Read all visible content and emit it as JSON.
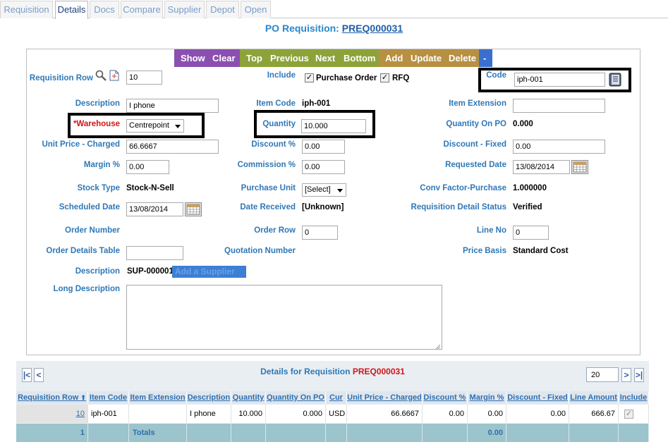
{
  "tabs": [
    {
      "label": "Requisition"
    },
    {
      "label": "Details"
    },
    {
      "label": "Docs"
    },
    {
      "label": "Compare"
    },
    {
      "label": "Supplier"
    },
    {
      "label": "Depot"
    },
    {
      "label": "Open"
    }
  ],
  "page": {
    "title_prefix": "PO Requisition:",
    "requisition_id": "PREQ000031"
  },
  "toolbar": {
    "show": "Show",
    "clear": "Clear",
    "top": "Top",
    "previous": "Previous",
    "next": "Next",
    "bottom": "Bottom",
    "add": "Add",
    "update": "Update",
    "delete": "Delete",
    "dash": "-"
  },
  "form": {
    "requisition_row_label": "Requisition Row",
    "requisition_row_value": "10",
    "include_label": "Include",
    "purchase_order_label": "Purchase Order",
    "rfq_label": "RFQ",
    "code_label": "Code",
    "code_value": "iph-001",
    "description_label": "Description",
    "description_value": "I phone",
    "item_code_label": "Item Code",
    "item_code_value": "iph-001",
    "item_extension_label": "Item Extension",
    "item_extension_value": "",
    "warehouse_label": "*Warehouse",
    "warehouse_value": "Centrepoint",
    "quantity_label": "Quantity",
    "quantity_value": "10.000",
    "quantity_on_po_label": "Quantity On PO",
    "quantity_on_po_value": "0.000",
    "unit_price_label": "Unit Price - Charged",
    "unit_price_value": "66.6667",
    "discount_pct_label": "Discount %",
    "discount_pct_value": "0.00",
    "discount_fixed_label": "Discount - Fixed",
    "discount_fixed_value": "0.00",
    "margin_label": "Margin %",
    "margin_value": "0.00",
    "commission_label": "Commission %",
    "commission_value": "0.00",
    "requested_date_label": "Requested Date",
    "requested_date_value": "13/08/2014",
    "stock_type_label": "Stock Type",
    "stock_type_value": "Stock-N-Sell",
    "purchase_unit_label": "Purchase Unit",
    "purchase_unit_value": "[Select]",
    "conv_factor_label": "Conv Factor-Purchase",
    "conv_factor_value": "1.000000",
    "scheduled_date_label": "Scheduled Date",
    "scheduled_date_value": "13/08/2014",
    "date_received_label": "Date Received",
    "date_received_value": "[Unknown]",
    "req_detail_status_label": "Requisition Detail Status",
    "req_detail_status_value": "Verified",
    "order_number_label": "Order Number",
    "order_row_label": "Order Row",
    "order_row_value": "0",
    "line_no_label": "Line No",
    "line_no_value": "0",
    "order_details_table_label": "Order Details Table",
    "order_details_table_value": "",
    "quotation_number_label": "Quotation Number",
    "price_basis_label": "Price Basis",
    "price_basis_value": "Standard Cost",
    "supplier_description_label": "Description",
    "supplier_description_value": "SUP-000001",
    "add_supplier_label": "Add a Supplier",
    "long_description_label": "Long Description",
    "long_description_value": ""
  },
  "grid": {
    "title_prefix": "Details for Requisition",
    "title_id": "PREQ000031",
    "page_size": "20",
    "nav": {
      "first": "|<",
      "prev": "<",
      "next": ">",
      "last": ">|"
    },
    "columns": [
      "Requisition Row",
      "Item Code",
      "Item Extension",
      "Description",
      "Quantity",
      "Quantity On PO",
      "Cur",
      "Unit Price - Charged",
      "Discount %",
      "Margin %",
      "Discount - Fixed",
      "Line Amount",
      "Include"
    ],
    "sort_icon": "sort-up-arrow",
    "rows": [
      [
        "10",
        "iph-001",
        "",
        "I phone",
        "10.000",
        "0.000",
        "USD",
        "66.6667",
        "0.00",
        "0.00",
        "0.00",
        "666.67",
        ""
      ]
    ],
    "footer": {
      "count": "1",
      "totals_label": "Totals",
      "margin_total": "0.00"
    }
  },
  "colors": {
    "show_clear_bg": "#8a4fb0",
    "nav_bg": "#8da33a",
    "crud_bg": "#b89042",
    "dash_bg": "#3a6fd0",
    "label_blue": "#2f78b7",
    "required_red": "#d11515"
  }
}
